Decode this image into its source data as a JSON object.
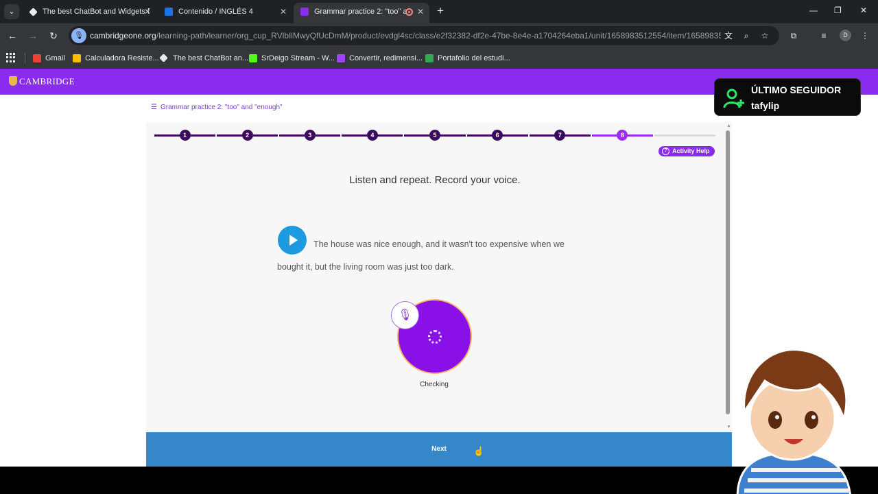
{
  "browser": {
    "tabs": [
      {
        "title": "The best ChatBot and Widgets f",
        "favicon_color": "#e8eaed",
        "active": false
      },
      {
        "title": "Contenido / INGLÉS 4",
        "favicon_color": "#1a73e8",
        "active": false
      },
      {
        "title": "Grammar practice 2: \"too\" a",
        "favicon_color": "#8a2cf0",
        "active": true
      }
    ],
    "url_domain": "cambridgeone.org",
    "url_path": "/learning-path/learner/org_cup_RVlbIlMwyQfUcDmM/product/evdgl4sc/class/e2f32382-df2e-47be-8e4e-a1704264eba1/unit/1658983512554/item/16589835...",
    "profile_initial": "D",
    "bookmarks": [
      {
        "label": "Gmail",
        "color": "#ea4335"
      },
      {
        "label": "Calculadora Resiste...",
        "color": "#fbbc04"
      },
      {
        "label": "The best ChatBot an...",
        "color": "#e8eaed"
      },
      {
        "label": "SrDeigo Stream - W...",
        "color": "#53fc18"
      },
      {
        "label": "Convertir, redimensi...",
        "color": "#a142f4"
      },
      {
        "label": "Portafolio del estudi...",
        "color": "#34a853"
      }
    ]
  },
  "site": {
    "brand": "CAMBRIDGE",
    "accent": "#8a2cf0",
    "breadcrumb": "Grammar practice 2: \"too\" and \"enough\""
  },
  "activity": {
    "steps": [
      "1",
      "2",
      "3",
      "4",
      "5",
      "6",
      "7",
      "8"
    ],
    "current_step": 8,
    "help_label": "Activity Help",
    "instruction": "Listen and repeat. Record your voice.",
    "sentence": "The house was nice enough, and it wasn't too expensive when we bought it, but the living room was just too dark.",
    "status": "Checking",
    "next_label": "Next"
  },
  "overlay": {
    "follower_title": "ÚLTIMO SEGUIDOR",
    "follower_name": "tafylip"
  }
}
